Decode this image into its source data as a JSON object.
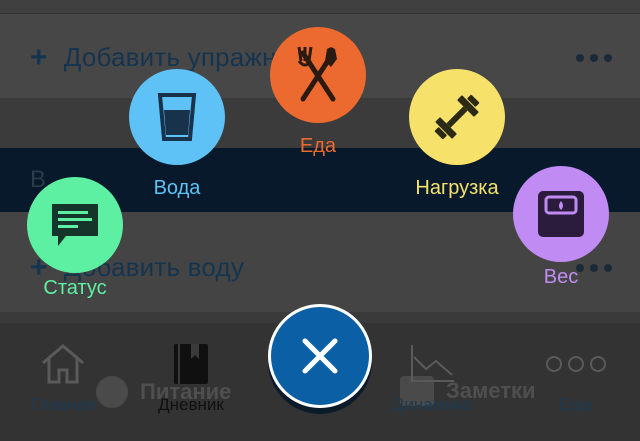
{
  "screen": {
    "exercise_add_label": "Добавить упражнение",
    "water_add_label": "Добавить воду",
    "band_text": "В",
    "plus_glyph": "+",
    "more_icon": "more-horizontal-icon"
  },
  "banner": {
    "left_label": "Питание",
    "right_label": "Заметки"
  },
  "tabbar": {
    "tabs": [
      {
        "label": "Главная",
        "icon": "home-icon"
      },
      {
        "label": "Дневник",
        "icon": "diary-icon",
        "active": true
      },
      {
        "label": "Динамика",
        "icon": "chart-icon"
      },
      {
        "label": "Еще",
        "icon": "more-icon"
      }
    ]
  },
  "actions": {
    "food": {
      "label": "Еда",
      "color": "#ec6a2f",
      "icon": "fork-knife-icon"
    },
    "water": {
      "label": "Вода",
      "color": "#5ec2f6",
      "icon": "glass-icon"
    },
    "load": {
      "label": "Нагрузка",
      "color": "#f6e26a",
      "icon": "dumbbell-icon"
    },
    "status": {
      "label": "Статус",
      "color": "#5ef0a2",
      "icon": "message-icon"
    },
    "weight": {
      "label": "Вес",
      "color": "#c08cf4",
      "icon": "scale-icon"
    }
  },
  "close_button": {
    "color": "#0b5fa5",
    "icon": "close-icon"
  }
}
